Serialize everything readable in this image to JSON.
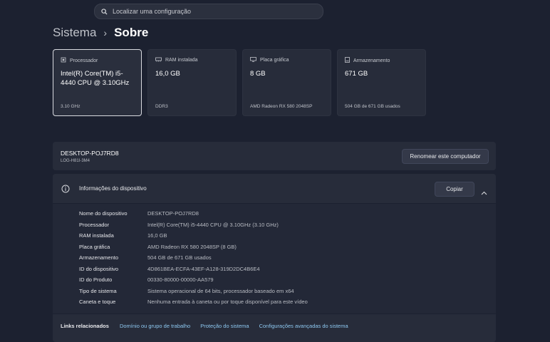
{
  "search": {
    "placeholder": "Localizar uma configuração"
  },
  "breadcrumb": {
    "parent": "Sistema",
    "separator": "›",
    "current": "Sobre"
  },
  "cards": [
    {
      "label": "Processador",
      "value": "Intel(R) Core(TM) i5-4440 CPU @ 3.10GHz",
      "sub": "3.10 GHz",
      "icon": "cpu-icon"
    },
    {
      "label": "RAM instalada",
      "value": "16,0 GB",
      "sub": "DDR3",
      "icon": "ram-icon"
    },
    {
      "label": "Placa gráfica",
      "value": "8 GB",
      "sub": "AMD Radeon RX 580 2048SP",
      "icon": "gpu-icon"
    },
    {
      "label": "Armazenamento",
      "value": "671 GB",
      "sub": "504 GB de 671 GB usados",
      "icon": "storage-icon"
    }
  ],
  "device": {
    "name": "DESKTOP-POJ7RD8",
    "model": "LOG-H81I-3M4",
    "rename_button": "Renomear este computador"
  },
  "device_info": {
    "title": "Informações do dispositivo",
    "copy_button": "Copiar",
    "specs": [
      {
        "key": "Nome do dispositivo",
        "value": "DESKTOP-POJ7RD8"
      },
      {
        "key": "Processador",
        "value": "Intel(R) Core(TM) i5-4440 CPU @ 3.10GHz (3.10 GHz)"
      },
      {
        "key": "RAM instalada",
        "value": "16,0 GB"
      },
      {
        "key": "Placa gráfica",
        "value": "AMD Radeon RX 580 2048SP (8 GB)"
      },
      {
        "key": "Armazenamento",
        "value": "504 GB de 671 GB usados"
      },
      {
        "key": "ID do dispositivo",
        "value": "4D861BEA-ECFA-43EF-A128-319D2DC4B6E4"
      },
      {
        "key": "ID do Produto",
        "value": "00330-80000-00000-AA579"
      },
      {
        "key": "Tipo de sistema",
        "value": "Sistema operacional de 64 bits, processador baseado em x64"
      },
      {
        "key": "Caneta e toque",
        "value": "Nenhuma entrada à caneta ou por toque disponível para este vídeo"
      }
    ]
  },
  "related_links": {
    "label": "Links relacionados",
    "items": [
      "Domínio ou grupo de trabalho",
      "Proteção do sistema",
      "Configurações avançadas do sistema"
    ]
  },
  "colors": {
    "background": "#1c2130",
    "card": "#272c3a",
    "link": "#8ec8f0"
  }
}
